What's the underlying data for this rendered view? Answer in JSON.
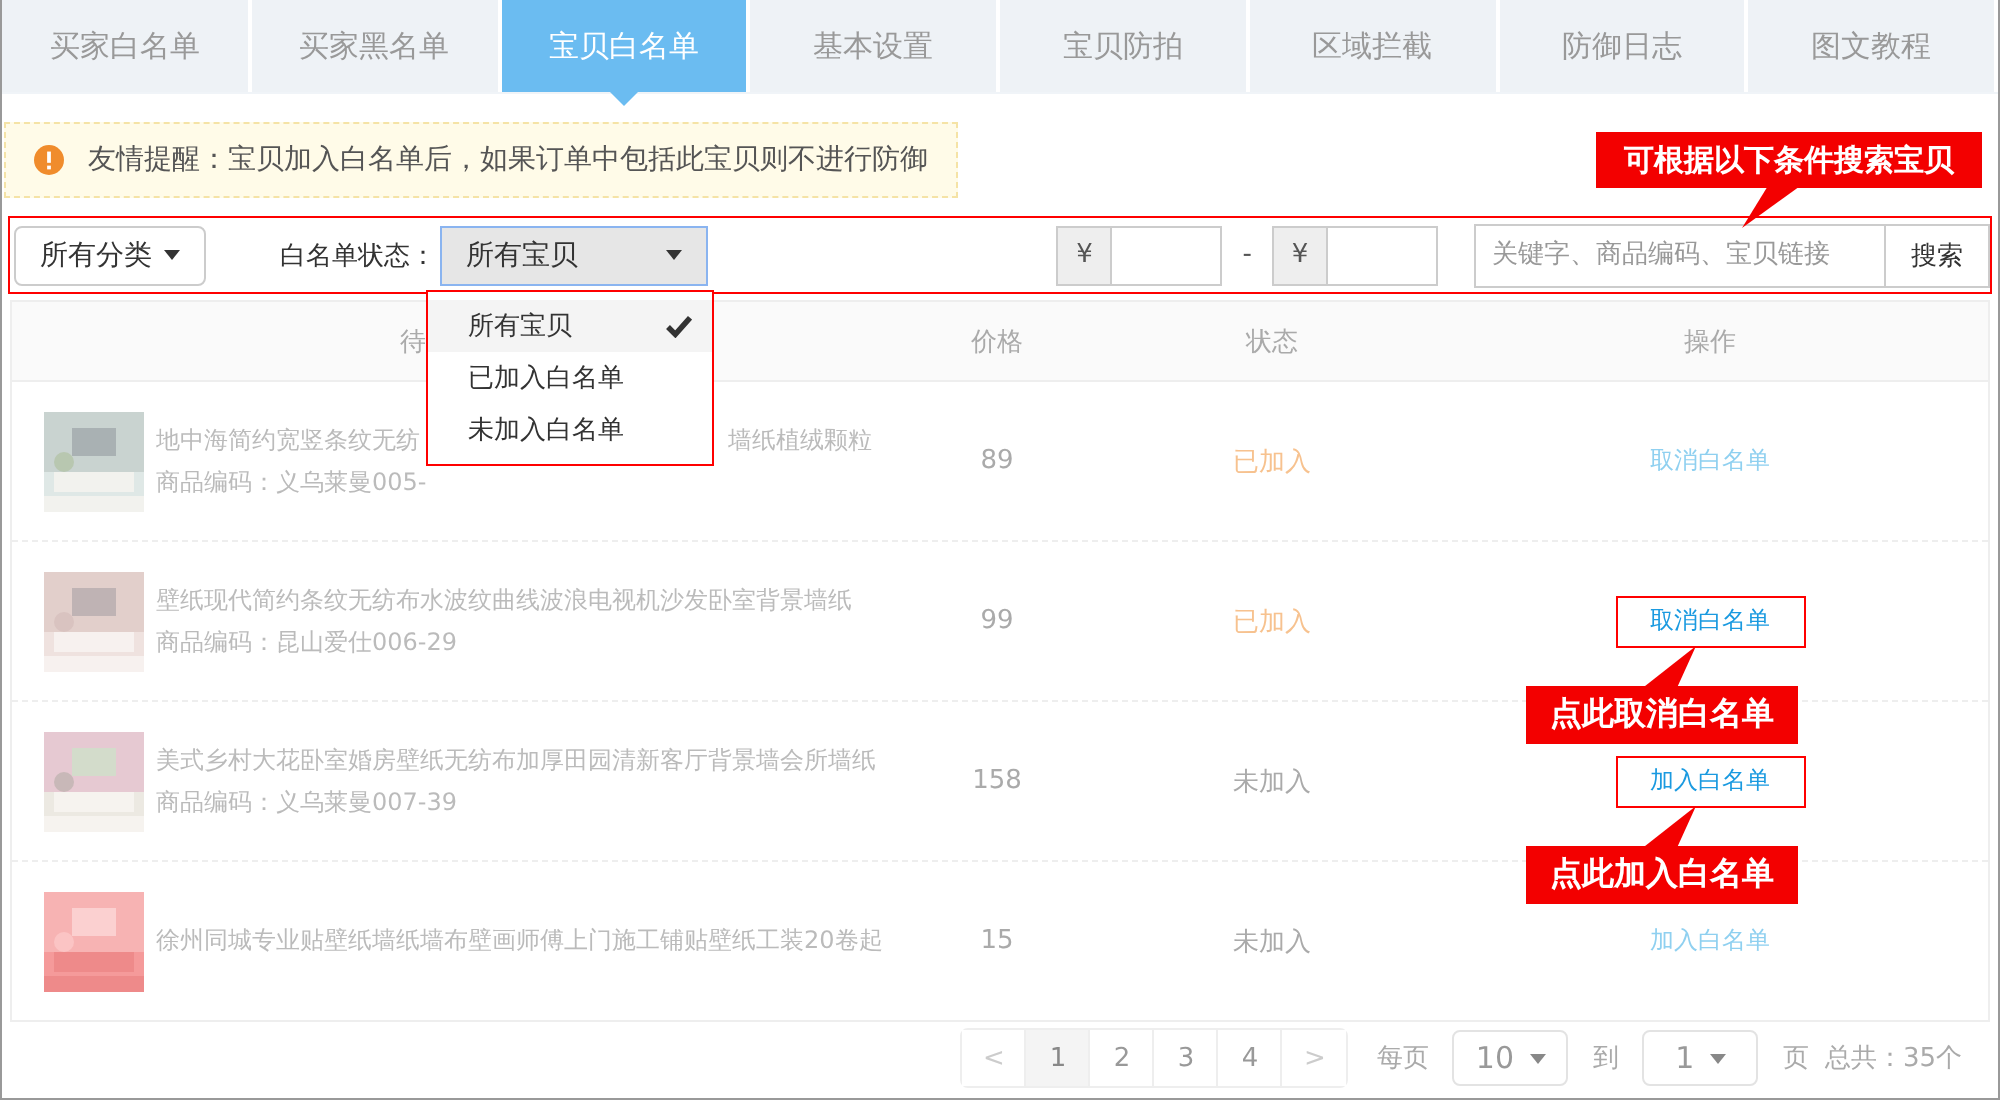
{
  "tabs": [
    {
      "label": "买家白名单",
      "selected": false
    },
    {
      "label": "买家黑名单",
      "selected": false
    },
    {
      "label": "宝贝白名单",
      "selected": true
    },
    {
      "label": "基本设置",
      "selected": false
    },
    {
      "label": "宝贝防拍",
      "selected": false
    },
    {
      "label": "区域拦截",
      "selected": false
    },
    {
      "label": "防御日志",
      "selected": false
    },
    {
      "label": "图文教程",
      "selected": false
    }
  ],
  "notice": "友情提醒：宝贝加入白名单后，如果订单中包括此宝贝则不进行防御",
  "search_hint": "可根据以下条件搜索宝贝",
  "filters": {
    "category": "所有分类",
    "status_label": "白名单状态：",
    "status_value": "所有宝贝",
    "currency_min": "¥",
    "range_separator": "-",
    "currency_max": "¥",
    "keyword_placeholder": "关键字、商品编码、宝贝链接",
    "search_button": "搜索"
  },
  "status_menu": [
    {
      "label": "所有宝贝",
      "selected": true
    },
    {
      "label": "已加入白名单",
      "selected": false
    },
    {
      "label": "未加入白名单",
      "selected": false
    }
  ],
  "table": {
    "columns": [
      "待",
      "价格",
      "状态",
      "操作"
    ],
    "rows": [
      {
        "title": "地中海简约宽竖条纹无纺",
        "title_tail": "墙纸植绒颗粒",
        "code": "商品编码：义乌莱曼005-",
        "price": "89",
        "status": "已加入",
        "added": true,
        "action": "取消白名单",
        "highlighted": false
      },
      {
        "title": "壁纸现代简约条纹无纺布水波纹曲线波浪电视机沙发卧室背景墙纸",
        "code": "商品编码：昆山爱仕006-29",
        "price": "99",
        "status": "已加入",
        "added": true,
        "action": "取消白名单",
        "highlighted": true,
        "note": "点此取消白名单"
      },
      {
        "title": "美式乡村大花卧室婚房壁纸无纺布加厚田园清新客厅背景墙会所墙纸",
        "code": "商品编码：义乌莱曼007-39",
        "price": "158",
        "status": "未加入",
        "added": false,
        "action": "加入白名单",
        "highlighted": true,
        "note": "点此加入白名单"
      },
      {
        "title": "徐州同城专业贴壁纸墙纸墙布壁画师傅上门施工铺贴壁纸工装20卷起",
        "price": "15",
        "status": "未加入",
        "added": false,
        "action": "加入白名单",
        "highlighted": false
      }
    ]
  },
  "pagination": {
    "prev": "<",
    "pages": [
      {
        "label": "1",
        "selected": true
      },
      {
        "label": "2",
        "selected": false
      },
      {
        "label": "3",
        "selected": false
      },
      {
        "label": "4",
        "selected": false
      }
    ],
    "next": ">",
    "per_page_label": "每页",
    "per_page": "10",
    "goto_label": "到",
    "goto_page": "1",
    "page_label": "页",
    "total": "总共：35个"
  }
}
